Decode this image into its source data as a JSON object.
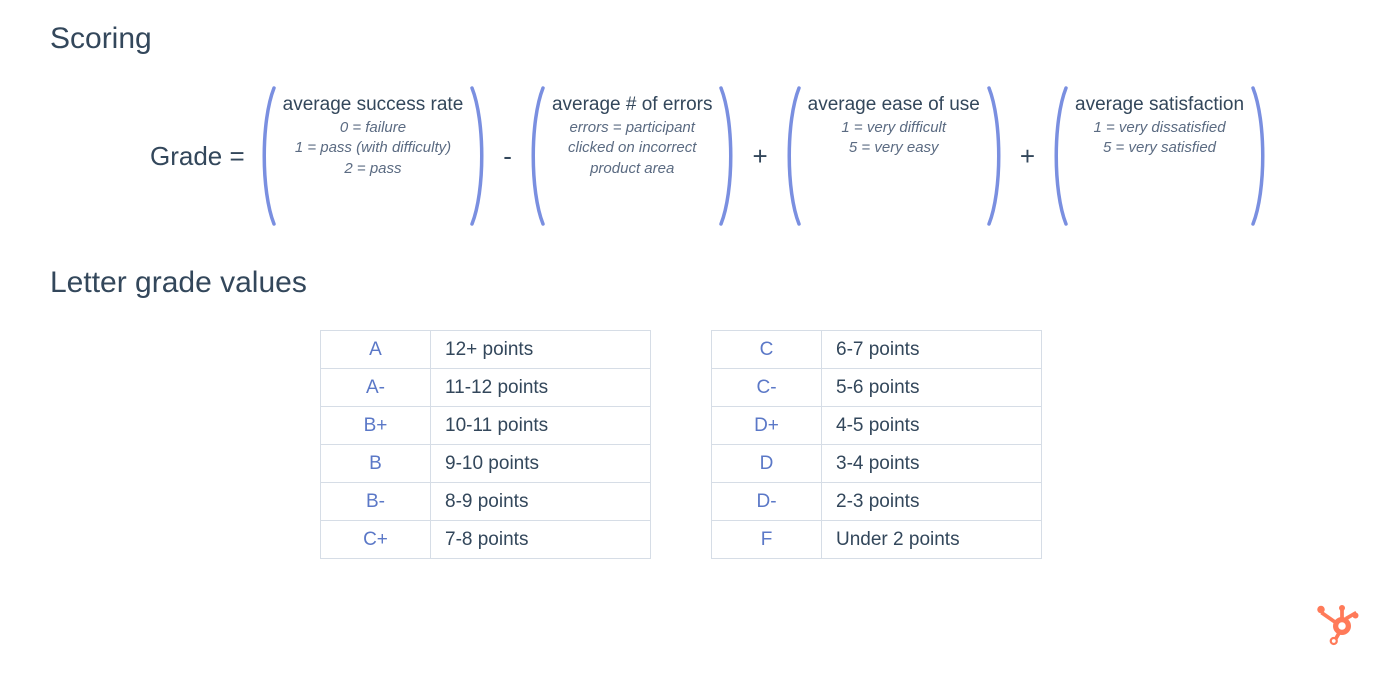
{
  "headings": {
    "scoring": "Scoring",
    "letter_grade_values": "Letter grade values"
  },
  "formula": {
    "lhs": "Grade =",
    "ops": [
      "-",
      "+",
      "+"
    ],
    "terms": [
      {
        "title": "average success rate",
        "subs": [
          "0 = failure",
          "1 = pass (with difficulty)",
          "2 = pass"
        ]
      },
      {
        "title": "average # of errors",
        "subs": [
          "errors = participant",
          "clicked on incorrect",
          "product area"
        ]
      },
      {
        "title": "average ease of use",
        "subs": [
          "1 = very difficult",
          "5 = very easy"
        ]
      },
      {
        "title": "average satisfaction",
        "subs": [
          "1 = very dissatisfied",
          "5 = very satisfied"
        ]
      }
    ]
  },
  "grade_tables": {
    "left": [
      {
        "letter": "A",
        "range": "12+ points"
      },
      {
        "letter": "A-",
        "range": "11-12 points"
      },
      {
        "letter": "B+",
        "range": "10-11 points"
      },
      {
        "letter": "B",
        "range": "9-10 points"
      },
      {
        "letter": "B-",
        "range": "8-9 points"
      },
      {
        "letter": "C+",
        "range": "7-8 points"
      }
    ],
    "right": [
      {
        "letter": "C",
        "range": "6-7 points"
      },
      {
        "letter": "C-",
        "range": "5-6 points"
      },
      {
        "letter": "D+",
        "range": "4-5 points"
      },
      {
        "letter": "D",
        "range": "3-4 points"
      },
      {
        "letter": "D-",
        "range": "2-3 points"
      },
      {
        "letter": "F",
        "range": "Under 2 points"
      }
    ]
  },
  "icons": {
    "brand_color": "#ff7a59"
  }
}
